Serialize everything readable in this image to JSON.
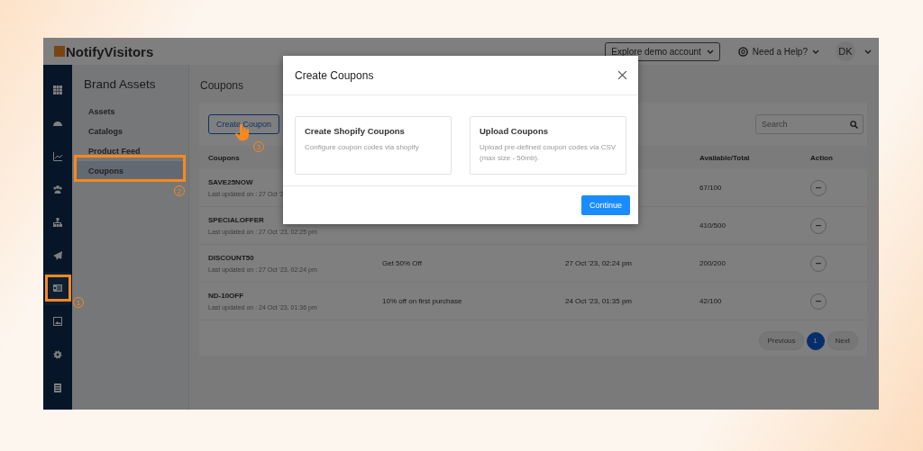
{
  "topbar": {
    "logo": "NotifyVisitors",
    "explore_button": "Explore demo account",
    "help": "Need a Help?",
    "avatar": "DK"
  },
  "rail": {
    "items": [
      {
        "kind": "grid",
        "selected": false
      },
      {
        "kind": "gauge",
        "selected": false
      },
      {
        "kind": "chart",
        "selected": false
      },
      {
        "kind": "users",
        "selected": false
      },
      {
        "kind": "hierarchy",
        "selected": false
      },
      {
        "kind": "send",
        "selected": false
      },
      {
        "kind": "list",
        "selected": true
      },
      {
        "kind": "image",
        "selected": false
      },
      {
        "kind": "gear",
        "selected": false
      },
      {
        "kind": "document",
        "selected": false
      }
    ]
  },
  "brand_panel": {
    "title": "Brand Assets",
    "items": [
      {
        "label": "Assets",
        "selected": false
      },
      {
        "label": "Catalogs",
        "selected": false
      },
      {
        "label": "Product Feed",
        "selected": false
      },
      {
        "label": "Coupons",
        "selected": true
      }
    ]
  },
  "content": {
    "title": "Coupons",
    "create_button": "Create Coupon",
    "search": {
      "placeholder": "Search"
    },
    "table": {
      "columns": [
        "Coupons",
        "Available/Total",
        "Action"
      ],
      "rows": [
        {
          "name": "SAVE25NOW",
          "updated": "Last updated on : 27 Oct '2",
          "available": "67/100"
        },
        {
          "name": "SPECIALOFFER",
          "updated": "Last updated on : 27 Oct '23, 02:25 pm",
          "available": "410/500"
        },
        {
          "name": "DISCOUNT50",
          "updated": "Last updated on : 27 Oct '23, 02:24 pm",
          "description": "Get 50% Off",
          "created": "27 Oct '23, 02:24 pm",
          "available": "200/200"
        },
        {
          "name": "ND-10OFF",
          "updated": "Last updated on : 24 Oct '23, 01:36 pm",
          "description": "10% off on first purchase",
          "created": "24 Oct '23, 01:35 pm",
          "available": "42/100"
        }
      ]
    },
    "pagination": {
      "previous": "Previous",
      "pages": [
        {
          "label": "1",
          "selected": true
        }
      ],
      "next": "Next"
    }
  },
  "dialog": {
    "title": "Create Coupons",
    "options": [
      {
        "title": "Create Shopify Coupons",
        "description": "Configure coupon codes via shopify"
      },
      {
        "title": "Upload Coupons",
        "description": "Upload pre-defined coupon codes via CSV (max size - 50mb)."
      }
    ],
    "continue_button": "Continue"
  },
  "annotations": [
    {
      "label": "1",
      "kind": "box"
    },
    {
      "label": "2",
      "kind": "box"
    },
    {
      "label": "3",
      "kind": "pointer"
    }
  ]
}
